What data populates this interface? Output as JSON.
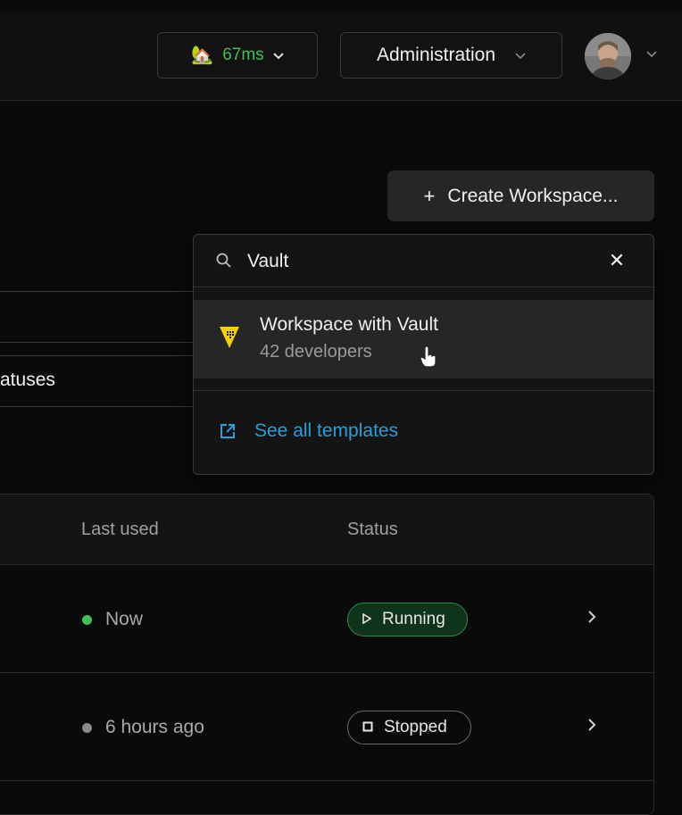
{
  "header": {
    "latency_icon": "🏡",
    "latency": "67ms",
    "admin_label": "Administration"
  },
  "create_button": {
    "plus": "+",
    "label": "Create Workspace..."
  },
  "filter": {
    "statuses_label": "atuses"
  },
  "dropdown": {
    "search_value": "Vault",
    "close": "✕",
    "templates": [
      {
        "name": "Workspace with Vault",
        "developers": "42 developers",
        "icon": "vault-icon"
      }
    ],
    "see_all": "See all templates"
  },
  "table": {
    "headers": {
      "last_used": "Last used",
      "status": "Status"
    },
    "rows": [
      {
        "last_used": "Now",
        "status": "Running",
        "status_icon": "▷",
        "dot_color": "#3fbf54"
      },
      {
        "last_used": "6 hours ago",
        "status": "Stopped",
        "status_icon": "◻",
        "dot_color": "#8a8a8a"
      }
    ]
  },
  "colors": {
    "accent_link": "#2a9fd8",
    "running": "#3fbf54",
    "vault_yellow": "#f5d000"
  }
}
